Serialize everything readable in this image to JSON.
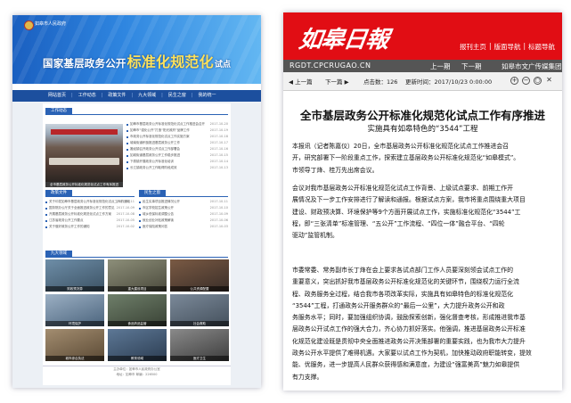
{
  "left_page": {
    "header": {
      "site_name": "如皋市人民政府",
      "title_prefix": "国家基层政务公开",
      "title_main": "标准化规范化",
      "title_suffix": "试点"
    },
    "nav": [
      "网站首页",
      "工作动态",
      "政策文件",
      "九大领域",
      "民生之窗",
      "我的统一"
    ],
    "sections": {
      "work": "工作动态",
      "policy": "政策文件",
      "livelihood": "民生之窗",
      "nine": "九大领域"
    },
    "photo_caption": "全市基层政务公开标准化规范化试点工作有序推进",
    "work_list": [
      {
        "text": "如皋市基层政务公开标准化规范化试点工作推进会召开",
        "date": "2017-10-20"
      },
      {
        "text": "如皋市“强化公开”打造“阳光政府”品牌工作",
        "date": "2017-10-19"
      },
      {
        "text": "市政务公开标准化规范化试点工作实施方案",
        "date": "2017-10-18"
      },
      {
        "text": "城南街道积极推进基层政务公开工作",
        "date": "2017-10-17"
      },
      {
        "text": "搬经镇召开政务公开试点工作部署会",
        "date": "2017-10-16"
      },
      {
        "text": "如城街道基层政务公开工作稳步推进",
        "date": "2017-10-15"
      },
      {
        "text": "下原镇开展政务公开标准化培训",
        "date": "2017-10-14"
      },
      {
        "text": "长江镇政务公开工作取得阶段成效",
        "date": "2017-10-13"
      }
    ],
    "policy_list": [
      {
        "text": "关于印发如皋市基层政务公开标准化规范化试点工作的通知",
        "date": "2017-10-11"
      },
      {
        "text": "国务院办公厅关于全面推进政务公开工作的意见",
        "date": "2017-10-09"
      },
      {
        "text": "开展基层政务公开标准化规范化试点工作方案",
        "date": "2017-10-08"
      },
      {
        "text": "江苏省政务公开工作要点",
        "date": "2017-10-05"
      },
      {
        "text": "关于做好政务公开工作的通知",
        "date": "2017-10-02"
      }
    ],
    "livelihood_list": [
      {
        "text": "民生实事项目推进情况公开",
        "date": "2017-10-11"
      },
      {
        "text": "市区学校招生政策公开",
        "date": "2017-10-10"
      },
      {
        "text": "城乡低保标准调整公告",
        "date": "2017-10-09"
      },
      {
        "text": "就业创业补贴政策解读",
        "date": "2017-10-06"
      },
      {
        "text": "医疗保险政策问答",
        "date": "2017-10-03"
      }
    ],
    "tiles": [
      "财政预决算",
      "重大建设项目",
      "公共资源配置",
      "环境保护",
      "食品药品监管",
      "社会救助",
      "城市综合执法",
      "教育领域",
      "医疗卫生"
    ],
    "footer": [
      "主办单位：如皋市人民政府办公室",
      "地址：如皋市 邮编：226500"
    ]
  },
  "right_page": {
    "logo": "如皋日報",
    "topnav": [
      "报刊主页",
      "版面导航",
      "标题导航"
    ],
    "site": "RGDT.CPCRUGAO.CN",
    "pager": {
      "prev": "上一期",
      "next": "下一期",
      "brand": "如皋市文广传媒集团"
    },
    "toolbar": {
      "prev": "上一篇",
      "next": "下一篇",
      "hits_label": "点击数：",
      "hits": "126",
      "updated_label": "更新时间：",
      "updated": "2017/10/23 0:00:00"
    },
    "article_title": "全市基层政务公开标准化规范化试点工作有序推进",
    "article_subtitle": "实施具有如皋特色的“3544”工程",
    "paragraphs": [
      [
        "本报讯（记者陈嘉仪）20日，全市基层政务公开标准化规范化试点工作推进会召",
        "开，研究部署下一阶段重点工作，探索建立基层政务公开标准化规范化“如皋模式”。",
        "市领导丁烽、桂万先出席会议。"
      ],
      [
        "会议对我市基层政务公开标准化规范化试点工作背景、上级试点要求、前期工作开",
        "展情况及下一步工作安排进行了解读和通报。根据试点方案，我市将重点围绕重大项目",
        "建设、财政预决算、环境保护等9个方面开展试点工作，实施标准化规范化“3544”工",
        "程，即“三张清单”标准管理、“五公开”工作流程、“四位一体”融合平台、“四轮",
        "驱动”监管机制。"
      ],
      [
        "市委常委、常务副市长丁烽在会上要求各试点部门工作人员要深刻领会试点工作的",
        "重要意义，突出抓好我市基层政务公开标准化规范化的关键环节，围绕权力运行全流",
        "程、政务服务全过程，结合我市各项改革实际，实施具有如皋特色的标准化规范化",
        "“3544”工程，打通政务公开服务群众的“最后一公里”，大力提升政务公开和政",
        "务服务水平；同时，要加强组织协调，鼓励探索创新，强化督查考核，形成推进我市基",
        "层政务公开试点工作的强大合力，齐心协力抓好落实。他强调，推进基层政务公开标准",
        "化规范化建设既是贯彻中央全面推进政务公开决策部署的重要实践，也为我市大力提升",
        "政务公开水平提供了难得机遇。大家要以试点工作为契机，加快推动政府职能转变，提效",
        "能、优服务，进一步提高人民群众获得感和满意度，为建设“强富美高”魅力如皋提供",
        "有力支撑。"
      ]
    ]
  }
}
